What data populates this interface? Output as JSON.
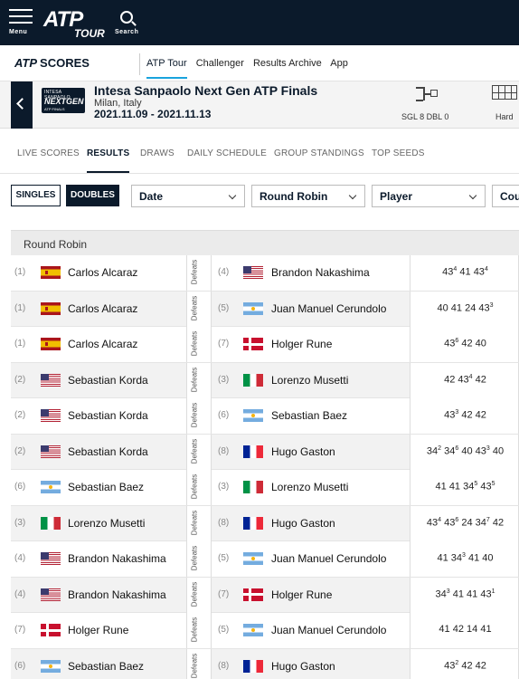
{
  "nav": {
    "menu_label": "Menu",
    "logo_main": "ATP",
    "logo_sub": "TOUR",
    "search_label": "Search"
  },
  "subnav": {
    "logo_atp": "ATP",
    "logo_scores": "SCORES",
    "links": [
      "ATP Tour",
      "Challenger",
      "Results Archive",
      "App"
    ]
  },
  "tournament": {
    "logo_line1": "INTESA SANPAOLO",
    "logo_line2": "NEXTGEN",
    "logo_line3": "ATP FINALS",
    "name": "Intesa Sanpaolo Next Gen ATP Finals",
    "location": "Milan, Italy",
    "dates": "2021.11.09 - 2021.11.13",
    "draw": "SGL 8 DBL 0",
    "surface": "Hard"
  },
  "tabs": [
    "LIVE SCORES",
    "RESULTS",
    "DRAWS",
    "DAILY SCHEDULE",
    "GROUP STANDINGS",
    "TOP SEEDS"
  ],
  "filters": {
    "singles": "SINGLES",
    "doubles": "DOUBLES",
    "date": "Date",
    "round": "Round Robin",
    "player": "Player",
    "country": "Cou"
  },
  "results": {
    "round_label": "Round Robin",
    "defeats_label": "Defeats",
    "matches": [
      {
        "wseed": "(1)",
        "wflag": "esp",
        "winner": "Carlos Alcaraz",
        "lseed": "(4)",
        "lflag": "usa",
        "loser": "Brandon Nakashima",
        "score": [
          [
            "4",
            "3",
            "4"
          ],
          [
            "4",
            "1",
            ""
          ],
          [
            "4",
            "3",
            "4"
          ]
        ]
      },
      {
        "wseed": "(1)",
        "wflag": "esp",
        "winner": "Carlos Alcaraz",
        "lseed": "(5)",
        "lflag": "arg",
        "loser": "Juan Manuel Cerundolo",
        "score": [
          [
            "4",
            "0",
            ""
          ],
          [
            "4",
            "1",
            ""
          ],
          [
            "2",
            "4",
            ""
          ],
          [
            "4",
            "3",
            "3"
          ]
        ]
      },
      {
        "wseed": "(1)",
        "wflag": "esp",
        "winner": "Carlos Alcaraz",
        "lseed": "(7)",
        "lflag": "den",
        "loser": "Holger Rune",
        "score": [
          [
            "4",
            "3",
            "6"
          ],
          [
            "4",
            "2",
            ""
          ],
          [
            "4",
            "0",
            ""
          ]
        ]
      },
      {
        "wseed": "(2)",
        "wflag": "usa",
        "winner": "Sebastian Korda",
        "lseed": "(3)",
        "lflag": "ita",
        "loser": "Lorenzo Musetti",
        "score": [
          [
            "4",
            "2",
            ""
          ],
          [
            "4",
            "3",
            "4"
          ],
          [
            "4",
            "2",
            ""
          ]
        ]
      },
      {
        "wseed": "(2)",
        "wflag": "usa",
        "winner": "Sebastian Korda",
        "lseed": "(6)",
        "lflag": "arg",
        "loser": "Sebastian Baez",
        "score": [
          [
            "4",
            "3",
            "3"
          ],
          [
            "4",
            "2",
            ""
          ],
          [
            "4",
            "2",
            ""
          ]
        ]
      },
      {
        "wseed": "(2)",
        "wflag": "usa",
        "winner": "Sebastian Korda",
        "lseed": "(8)",
        "lflag": "fra",
        "loser": "Hugo Gaston",
        "score": [
          [
            "3",
            "4",
            "2"
          ],
          [
            "3",
            "4",
            "6"
          ],
          [
            "4",
            "0",
            ""
          ],
          [
            "4",
            "3",
            "3"
          ],
          [
            "4",
            "0",
            ""
          ]
        ]
      },
      {
        "wseed": "(6)",
        "wflag": "arg",
        "winner": "Sebastian Baez",
        "lseed": "(3)",
        "lflag": "ita",
        "loser": "Lorenzo Musetti",
        "score": [
          [
            "4",
            "1",
            ""
          ],
          [
            "4",
            "1",
            ""
          ],
          [
            "3",
            "4",
            "5"
          ],
          [
            "4",
            "3",
            "5"
          ]
        ]
      },
      {
        "wseed": "(3)",
        "wflag": "ita",
        "winner": "Lorenzo Musetti",
        "lseed": "(8)",
        "lflag": "fra",
        "loser": "Hugo Gaston",
        "score": [
          [
            "4",
            "3",
            "4"
          ],
          [
            "4",
            "3",
            "6"
          ],
          [
            "2",
            "4",
            ""
          ],
          [
            "3",
            "4",
            "7"
          ],
          [
            "4",
            "2",
            ""
          ]
        ]
      },
      {
        "wseed": "(4)",
        "wflag": "usa",
        "winner": "Brandon Nakashima",
        "lseed": "(5)",
        "lflag": "arg",
        "loser": "Juan Manuel Cerundolo",
        "score": [
          [
            "4",
            "1",
            ""
          ],
          [
            "3",
            "4",
            "3"
          ],
          [
            "4",
            "1",
            ""
          ],
          [
            "4",
            "0",
            ""
          ]
        ]
      },
      {
        "wseed": "(4)",
        "wflag": "usa",
        "winner": "Brandon Nakashima",
        "lseed": "(7)",
        "lflag": "den",
        "loser": "Holger Rune",
        "score": [
          [
            "3",
            "4",
            "3"
          ],
          [
            "4",
            "1",
            ""
          ],
          [
            "4",
            "1",
            ""
          ],
          [
            "4",
            "3",
            "1"
          ]
        ]
      },
      {
        "wseed": "(7)",
        "wflag": "den",
        "winner": "Holger Rune",
        "lseed": "(5)",
        "lflag": "arg",
        "loser": "Juan Manuel Cerundolo",
        "score": [
          [
            "4",
            "1",
            ""
          ],
          [
            "4",
            "2",
            ""
          ],
          [
            "1",
            "4",
            ""
          ],
          [
            "4",
            "1",
            ""
          ]
        ]
      },
      {
        "wseed": "(6)",
        "wflag": "arg",
        "winner": "Sebastian Baez",
        "lseed": "(8)",
        "lflag": "fra",
        "loser": "Hugo Gaston",
        "score": [
          [
            "4",
            "3",
            "2"
          ],
          [
            "4",
            "2",
            ""
          ],
          [
            "4",
            "2",
            ""
          ]
        ]
      }
    ]
  }
}
